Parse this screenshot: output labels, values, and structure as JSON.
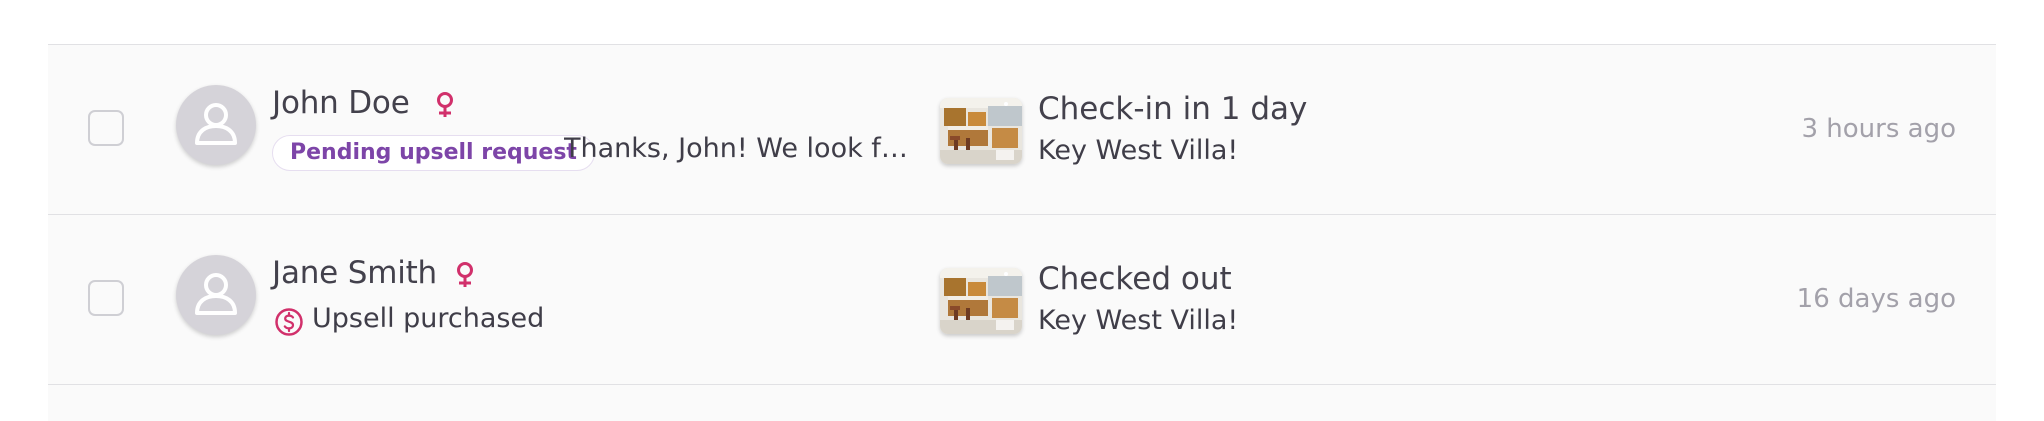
{
  "conversations": [
    {
      "guest_name": "John Doe",
      "gender_icon": "female-symbol-icon",
      "badge": "Pending upsell request",
      "message_preview": "Thanks, John! We look forw...",
      "stay_status": "Check-in in 1 day",
      "listing": "Key West Villa!",
      "time": "3 hours ago"
    },
    {
      "guest_name": "Jane Smith",
      "gender_icon": "female-symbol-icon",
      "upsell_icon": "dollar-circle-icon",
      "upsell_status": "Upsell purchased",
      "stay_status": "Checked out",
      "listing": "Key West Villa!",
      "time": "16 days ago"
    }
  ],
  "colors": {
    "accent_pink": "#d1306b",
    "badge_purple": "#7d45a8",
    "timestamp_grey": "#a3a1aa"
  }
}
